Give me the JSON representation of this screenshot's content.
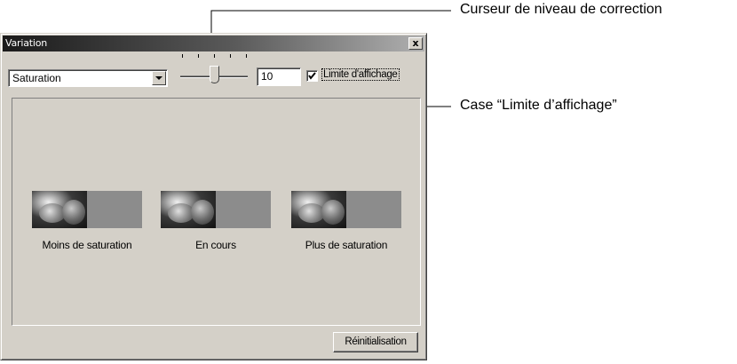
{
  "window": {
    "title": "Variation",
    "close_label": "x"
  },
  "controls": {
    "dropdown_value": "Saturation",
    "slider_level": 0.5,
    "number_value": "10",
    "checkbox_checked": true,
    "checkbox_label": "Limite d'affichage"
  },
  "previews": [
    {
      "caption": "Moins de saturation"
    },
    {
      "caption": "En cours"
    },
    {
      "caption": "Plus de saturation"
    }
  ],
  "reset_label": "Réinitialisation",
  "callouts": {
    "slider": "Curseur de niveau de correction",
    "checkbox": "Case “Limite d’affichage”"
  }
}
